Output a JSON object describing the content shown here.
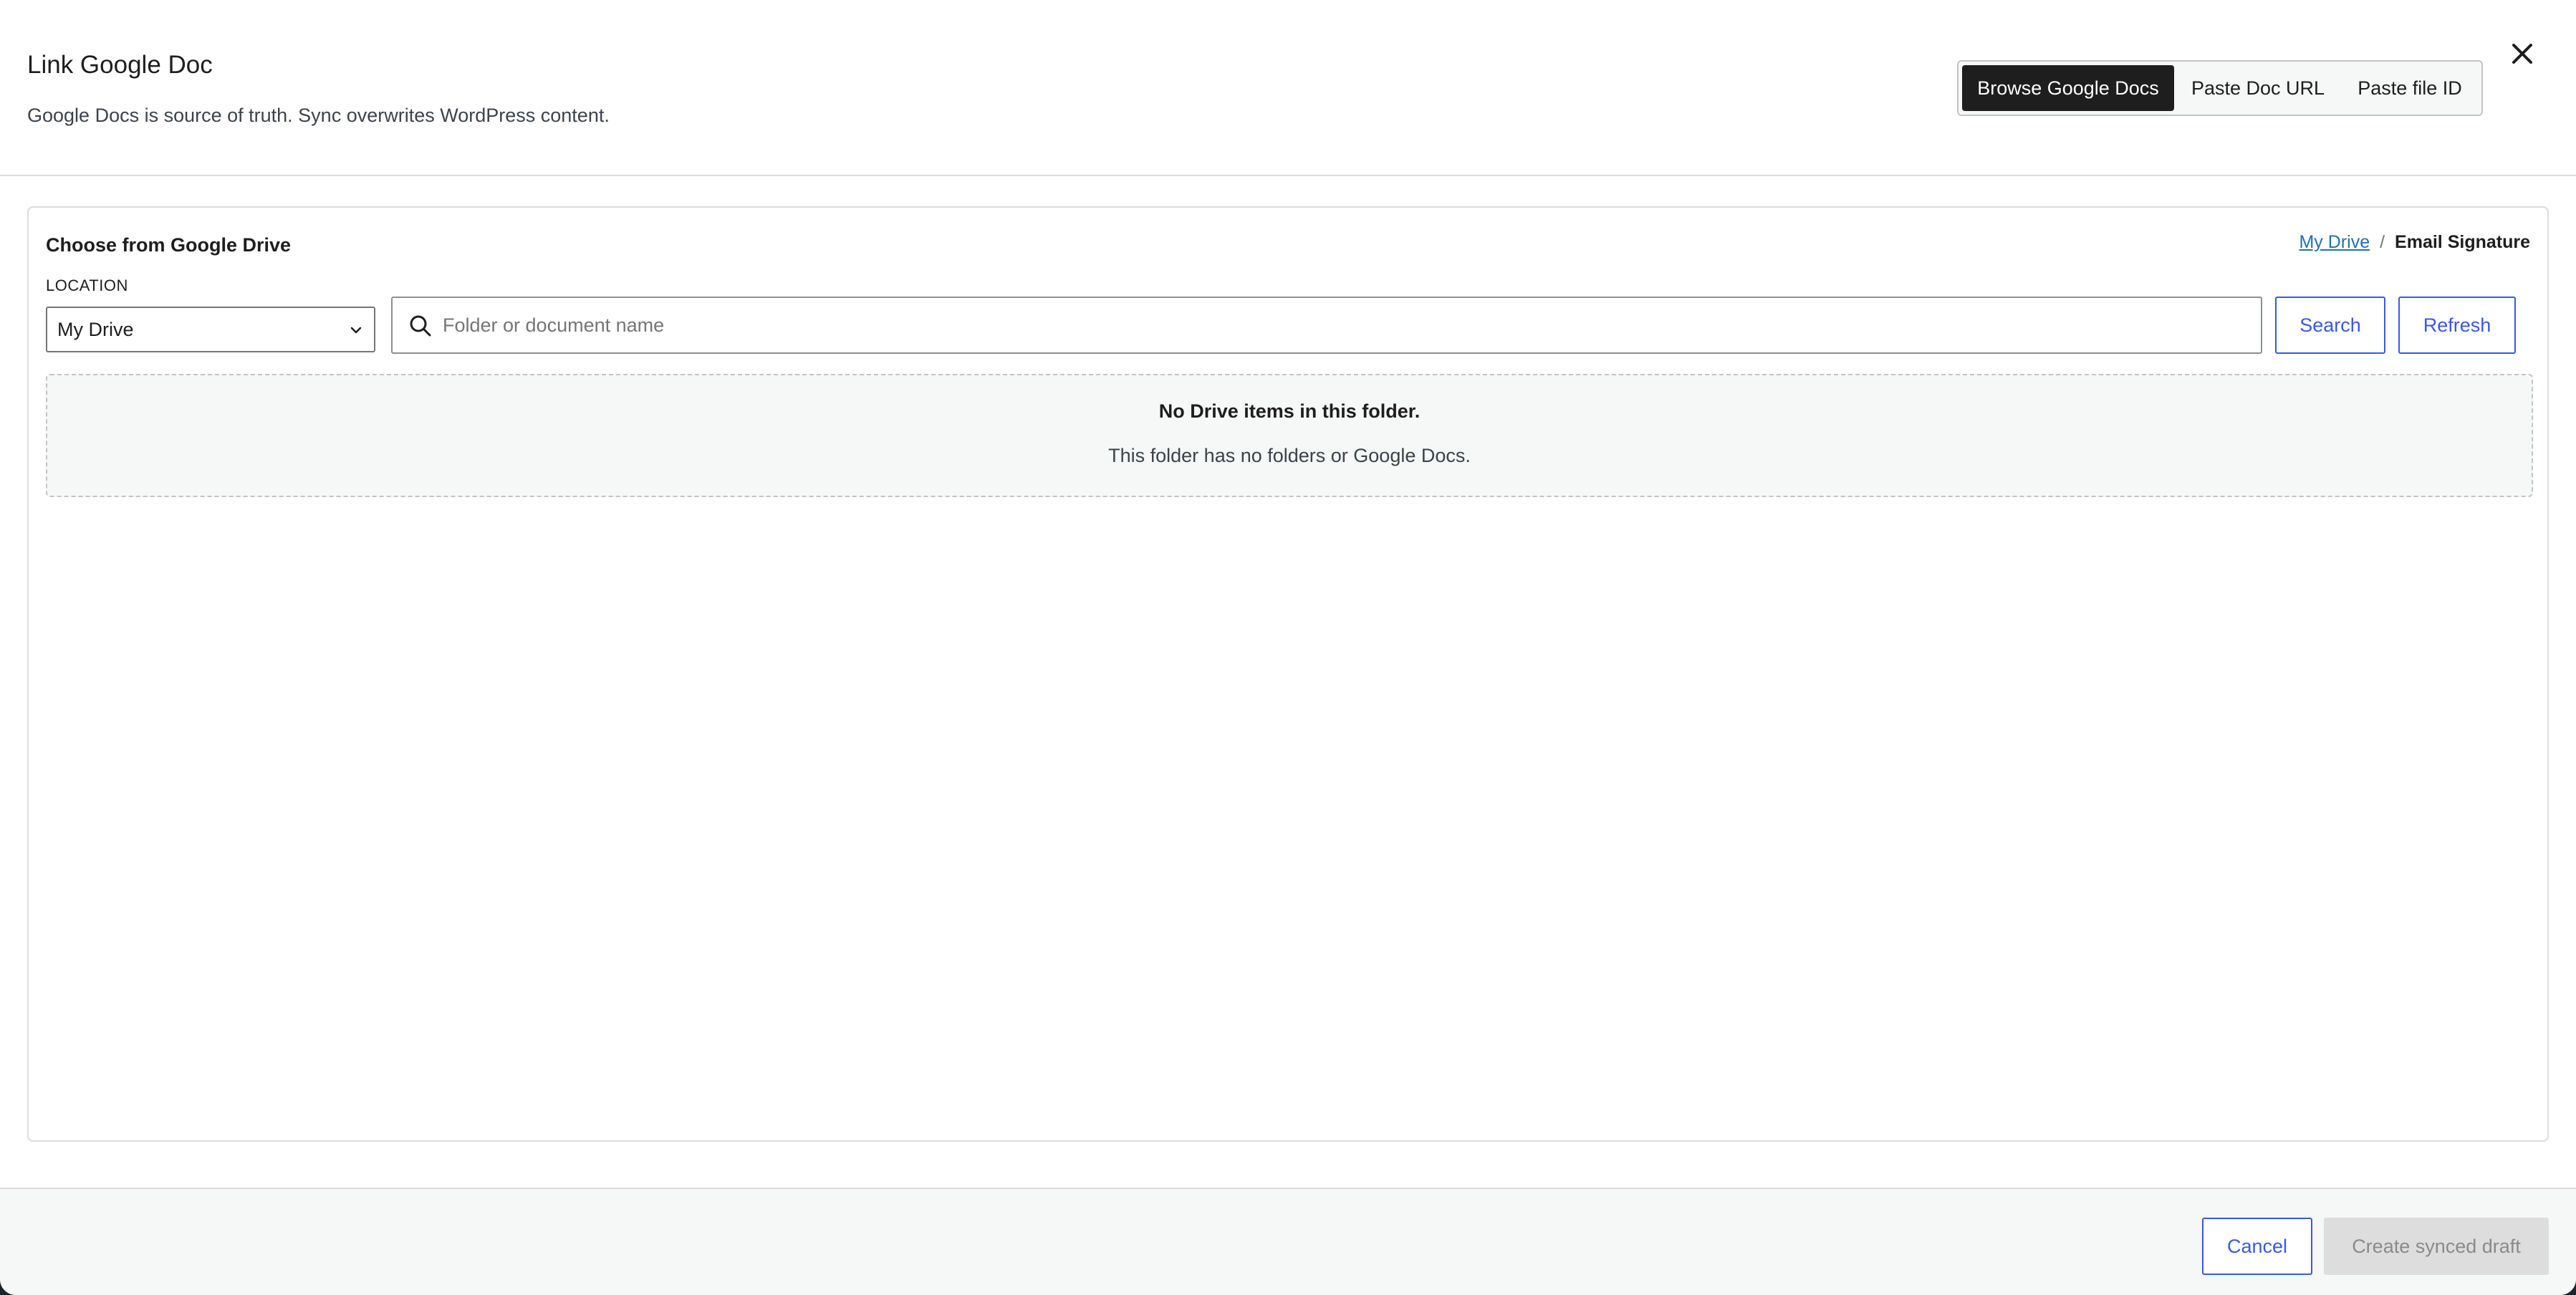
{
  "dialog": {
    "title": "Link Google Doc",
    "subtitle": "Google Docs is source of truth. Sync overwrites WordPress content.",
    "modes": [
      {
        "label": "Browse Google Docs",
        "active": true
      },
      {
        "label": "Paste Doc URL",
        "active": false
      },
      {
        "label": "Paste file ID",
        "active": false
      }
    ],
    "close_icon": "close-icon"
  },
  "browser": {
    "title": "Choose from Google Drive",
    "breadcrumb": {
      "root": "My Drive",
      "separator": "/",
      "current": "Email Signature"
    },
    "location_label": "LOCATION",
    "location_value": "My Drive",
    "search": {
      "placeholder": "Folder or document name",
      "value": ""
    },
    "search_button": "Search",
    "refresh_button": "Refresh",
    "empty": {
      "title": "No Drive items in this folder.",
      "description": "This folder has no folders or Google Docs."
    }
  },
  "footer": {
    "cancel": "Cancel",
    "create": "Create synced draft",
    "create_disabled": true
  },
  "colors": {
    "accent": "#3858e9",
    "active_mode_bg": "#1e1e1e",
    "link": "#2271b1",
    "disabled_bg": "#dddddd"
  }
}
